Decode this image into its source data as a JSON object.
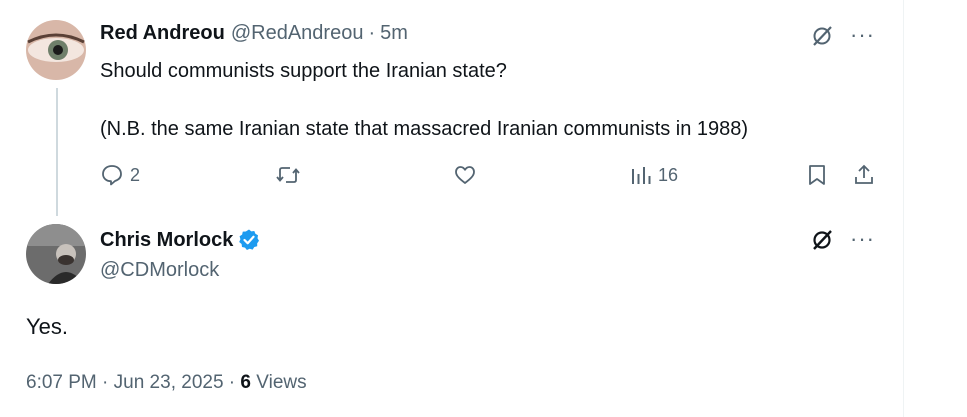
{
  "tweet1": {
    "name": "Red Andreou",
    "handle": "@RedAndreou",
    "separator": "·",
    "time": "5m",
    "line1": "Should communists support the Iranian state?",
    "line2": "(N.B. the same Iranian state that massacred Iranian communists in 1988)",
    "replies": "2",
    "views": "16"
  },
  "tweet2": {
    "name": "Chris Morlock",
    "handle": "@CDMorlock",
    "text": "Yes.",
    "time": "6:07 PM · Jun 23, 2025 · ",
    "views_count": "6",
    "views_label": " Views"
  },
  "more_label": "···",
  "colors": {
    "verified": "#1d9bf0",
    "muted": "#536471",
    "text": "#0f1419"
  }
}
